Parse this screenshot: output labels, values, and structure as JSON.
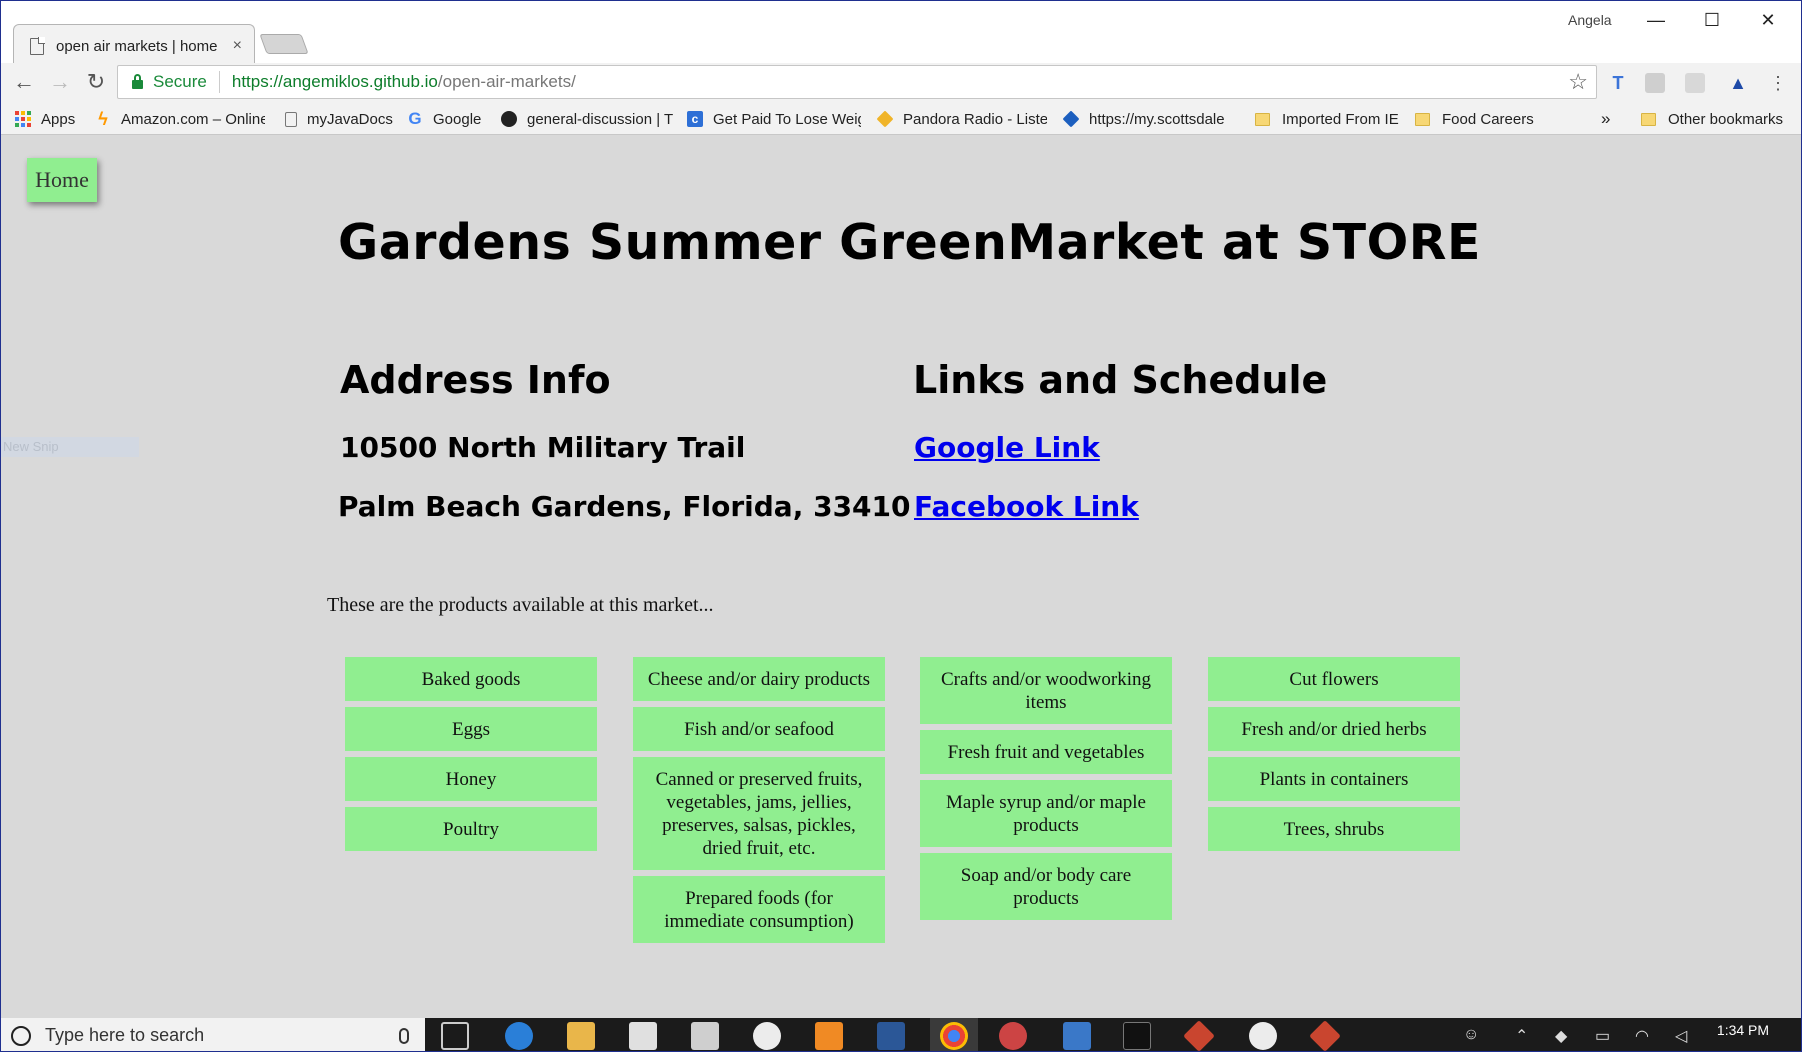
{
  "browser": {
    "tab_title": "open air markets | home",
    "tab_close": "×",
    "profile_name": "Angela",
    "window_controls": {
      "minimize": "—",
      "maximize": "☐",
      "close": "✕"
    },
    "nav": {
      "back": "←",
      "forward": "→",
      "reload": "↻"
    },
    "address_bar": {
      "secure_label": "Secure",
      "url_origin": "https://angemiklos.github.io",
      "url_path": "/open-air-markets/",
      "star_icon": "☆"
    },
    "bookmarks": [
      {
        "label": "Apps",
        "icon": "apps-grid-icon"
      },
      {
        "label": "Amazon.com – Online",
        "icon": "amazon-bolt-icon"
      },
      {
        "label": "myJavaDocs",
        "icon": "page-icon"
      },
      {
        "label": "Google",
        "icon": "google-g-icon"
      },
      {
        "label": "general-discussion | T",
        "icon": "github-icon"
      },
      {
        "label": "Get Paid To Lose Weig",
        "icon": "c-logo-icon"
      },
      {
        "label": "Pandora Radio - Liste",
        "icon": "pandora-diamond-icon"
      },
      {
        "label": "https://my.scottsdale",
        "icon": "scottsdale-diamond-icon"
      },
      {
        "label": "Imported From IE",
        "icon": "folder-icon"
      },
      {
        "label": "Food Careers",
        "icon": "folder-icon"
      }
    ],
    "bookmarks_overflow": "»",
    "other_bookmarks": "Other bookmarks"
  },
  "page": {
    "home_button": "Home",
    "snip_ghost": "New Snip",
    "title": "Gardens Summer GreenMarket at STORE",
    "address": {
      "heading": "Address Info",
      "line1": "10500 North Military Trail",
      "line2": "Palm Beach Gardens, Florida, 33410"
    },
    "links": {
      "heading": "Links and Schedule",
      "google": "Google Link",
      "facebook": "Facebook Link"
    },
    "products_intro": "These are the products available at this market...",
    "product_columns": [
      [
        "Baked goods",
        "Eggs",
        "Honey",
        "Poultry"
      ],
      [
        "Cheese and/or dairy products",
        "Fish and/or seafood",
        "Canned or preserved fruits, vegetables, jams, jellies, preserves, salsas, pickles, dried fruit, etc.",
        "Prepared foods (for immediate consumption)"
      ],
      [
        "Crafts and/or woodworking items",
        "Fresh fruit and vegetables",
        "Maple syrup and/or maple products",
        "Soap and/or body care products"
      ],
      [
        "Cut flowers",
        "Fresh and/or dried herbs",
        "Plants in containers",
        "Trees, shrubs"
      ]
    ]
  },
  "taskbar": {
    "search_placeholder": "Type here to search",
    "clock_time": "1:34 PM"
  },
  "colors": {
    "chip_green": "#90ee90",
    "page_bg": "#d9d9d9",
    "link_blue": "#0000ee",
    "secure_green": "#1a8a3a"
  }
}
